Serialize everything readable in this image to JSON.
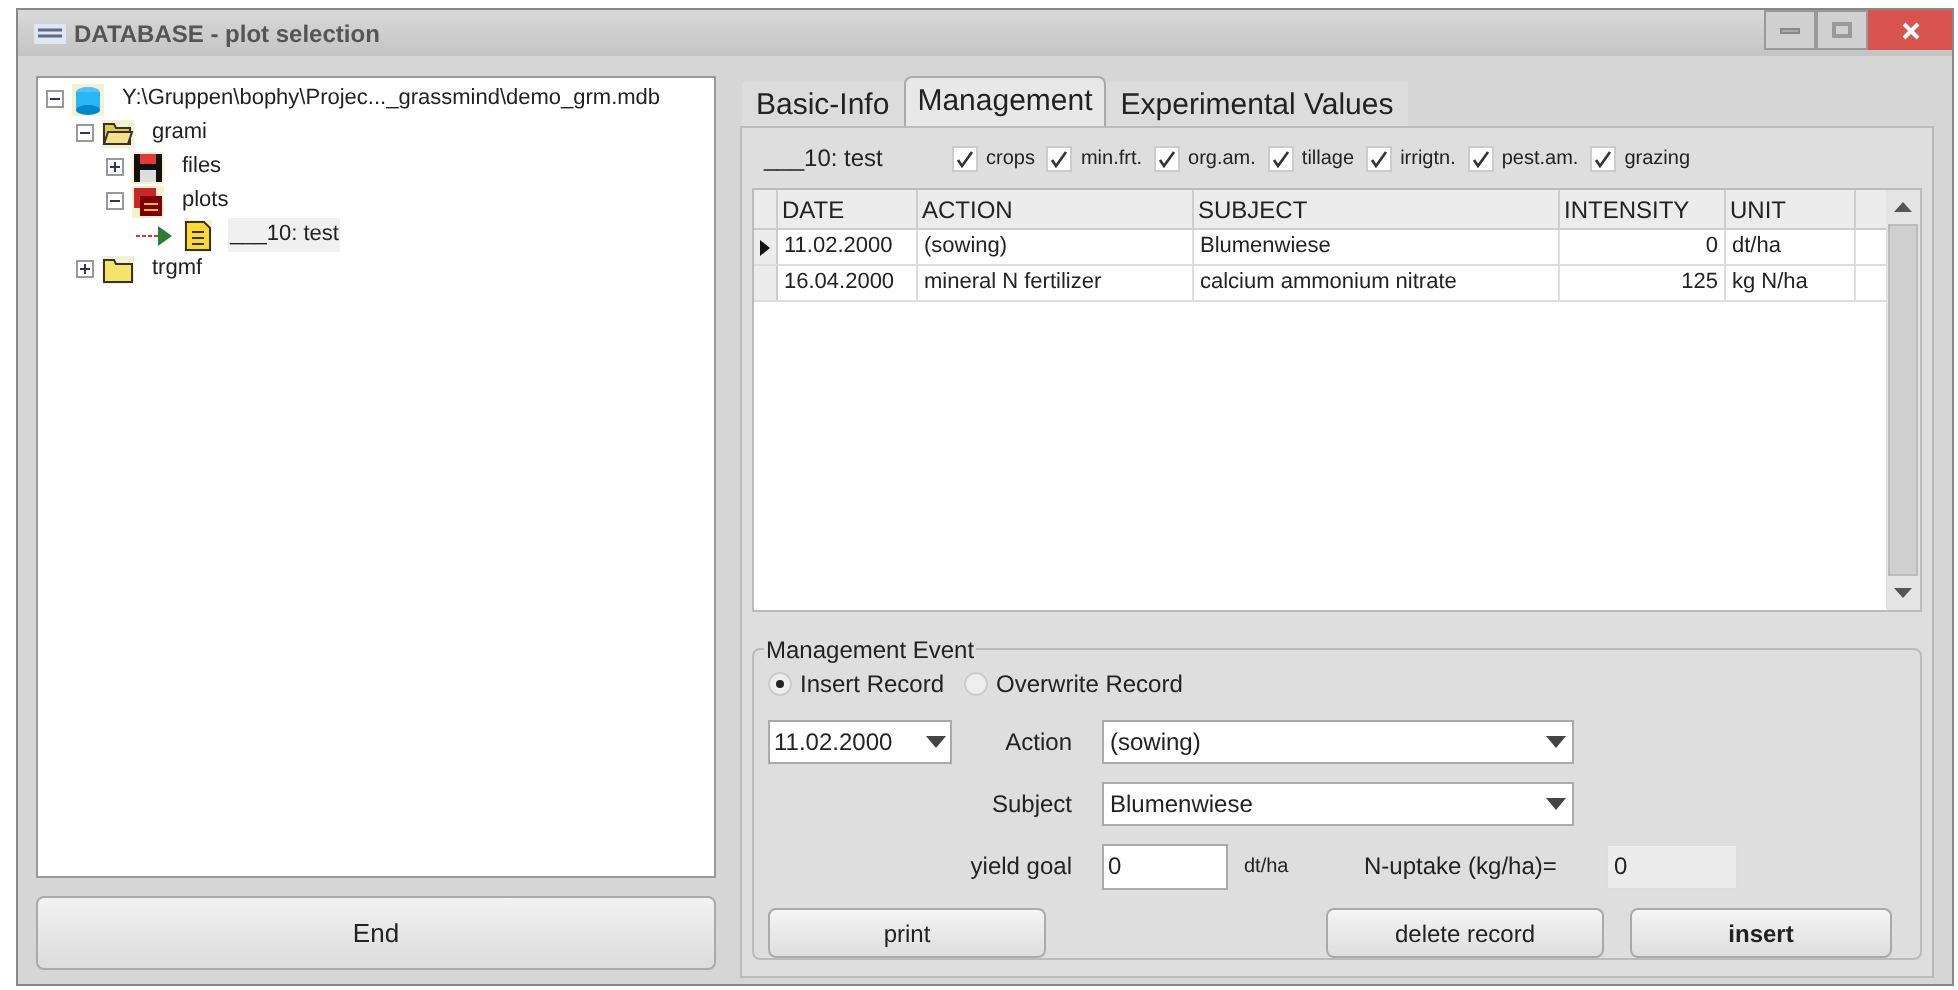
{
  "window": {
    "title": "DATABASE - plot selection"
  },
  "tree": [
    {
      "label": "Y:\\Gruppen\\bophy\\Projec..._grassmind\\demo_grm.mdb",
      "kind": "database",
      "expanded": true,
      "children": [
        {
          "label": "grami",
          "kind": "folder-open",
          "expanded": true,
          "children": [
            {
              "label": "files",
              "kind": "disk",
              "expanded": false
            },
            {
              "label": "plots",
              "kind": "plots",
              "expanded": true,
              "children": [
                {
                  "label": "___10: test",
                  "kind": "plot",
                  "selected": true
                }
              ]
            }
          ]
        },
        {
          "label": "trgmf",
          "kind": "folder",
          "expanded": false
        }
      ]
    }
  ],
  "end_button": "End",
  "tabs": [
    {
      "label": "Basic-Info",
      "selected": false
    },
    {
      "label": "Management",
      "selected": true
    },
    {
      "label": "Experimental Values",
      "selected": false
    }
  ],
  "plot_label": "___10: test",
  "filters": [
    {
      "label": "crops",
      "checked": true
    },
    {
      "label": "min.frt.",
      "checked": true
    },
    {
      "label": "org.am.",
      "checked": true
    },
    {
      "label": "tillage",
      "checked": true
    },
    {
      "label": "irrigtn.",
      "checked": true
    },
    {
      "label": "pest.am.",
      "checked": true
    },
    {
      "label": "grazing",
      "checked": true
    }
  ],
  "table": {
    "columns": [
      "DATE",
      "ACTION",
      "SUBJECT",
      "INTENSITY",
      "UNIT"
    ],
    "rows": [
      {
        "cells": [
          "11.02.2000",
          "(sowing)",
          "Blumenwiese",
          "0",
          "dt/ha"
        ],
        "selected": true
      },
      {
        "cells": [
          "16.04.2000",
          "mineral N fertilizer",
          "calcium ammonium nitrate",
          "125",
          "kg N/ha"
        ],
        "selected": false
      }
    ]
  },
  "event": {
    "title": "Management Event",
    "modes": [
      {
        "label": "Insert Record",
        "selected": true
      },
      {
        "label": "Overwrite Record",
        "selected": false
      }
    ],
    "date": "11.02.2000",
    "action_label": "Action",
    "action": "(sowing)",
    "subject_label": "Subject",
    "subject": "Blumenwiese",
    "yield_label": "yield goal",
    "yield": "0",
    "yield_unit": "dt/ha",
    "uptake_label": "N-uptake (kg/ha)=",
    "uptake": "0"
  },
  "buttons": [
    {
      "label": "print",
      "kind": "normal"
    },
    {
      "label": "delete record",
      "kind": "normal"
    },
    {
      "label": "insert",
      "kind": "default"
    }
  ]
}
